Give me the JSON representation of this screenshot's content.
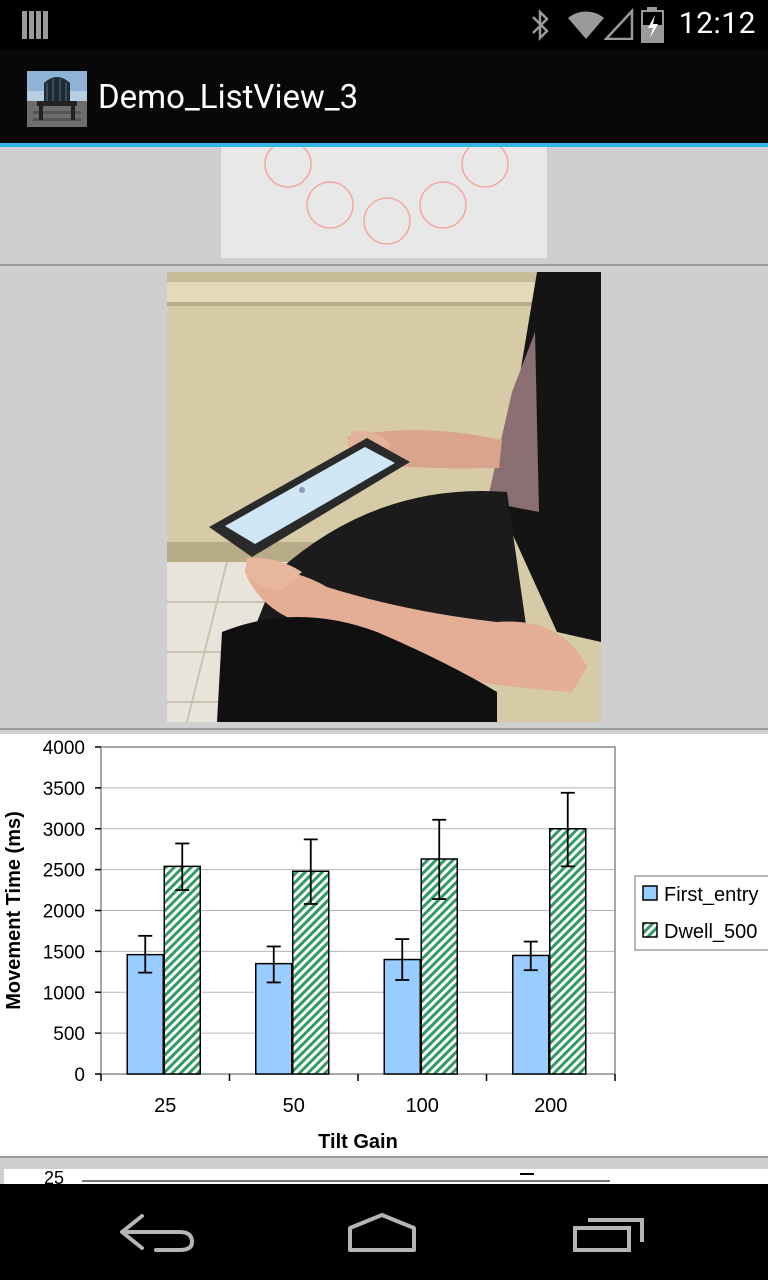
{
  "status_bar": {
    "time": "12:12",
    "icons": [
      "notification-bars-icon",
      "bluetooth-icon",
      "wifi-icon",
      "signal-icon",
      "battery-charging-icon"
    ]
  },
  "action_bar": {
    "title": "Demo_ListView_3",
    "app_icon": "adirondack-chair-icon"
  },
  "list_items": [
    {
      "kind": "image",
      "subject": "target circles pattern"
    },
    {
      "kind": "photo",
      "subject": "person holding tablet"
    },
    {
      "kind": "chart"
    },
    {
      "kind": "chart-partial",
      "visible_tick": "25"
    }
  ],
  "chart_data": {
    "type": "bar",
    "categories": [
      "25",
      "50",
      "100",
      "200"
    ],
    "series": [
      {
        "name": "First_entry",
        "values": [
          1460,
          1350,
          1400,
          1450
        ],
        "error_low": [
          1240,
          1120,
          1150,
          1270
        ],
        "error_high": [
          1690,
          1560,
          1650,
          1620
        ],
        "color": "#99ccff"
      },
      {
        "name": "Dwell_500",
        "values": [
          2540,
          2480,
          2630,
          3000
        ],
        "error_low": [
          2250,
          2080,
          2140,
          2540
        ],
        "error_high": [
          2820,
          2870,
          3110,
          3440
        ],
        "color": "#339966"
      }
    ],
    "yticks": [
      "0",
      "500",
      "1000",
      "1500",
      "2000",
      "2500",
      "3000",
      "3500",
      "4000"
    ],
    "xlabel": "Tilt Gain",
    "ylabel": "Movement Time (ms)",
    "ylim": [
      0,
      4000
    ],
    "grid": true,
    "legend": "right"
  },
  "nav_bar": {
    "buttons": [
      "back-icon",
      "home-icon",
      "recent-apps-icon"
    ]
  }
}
